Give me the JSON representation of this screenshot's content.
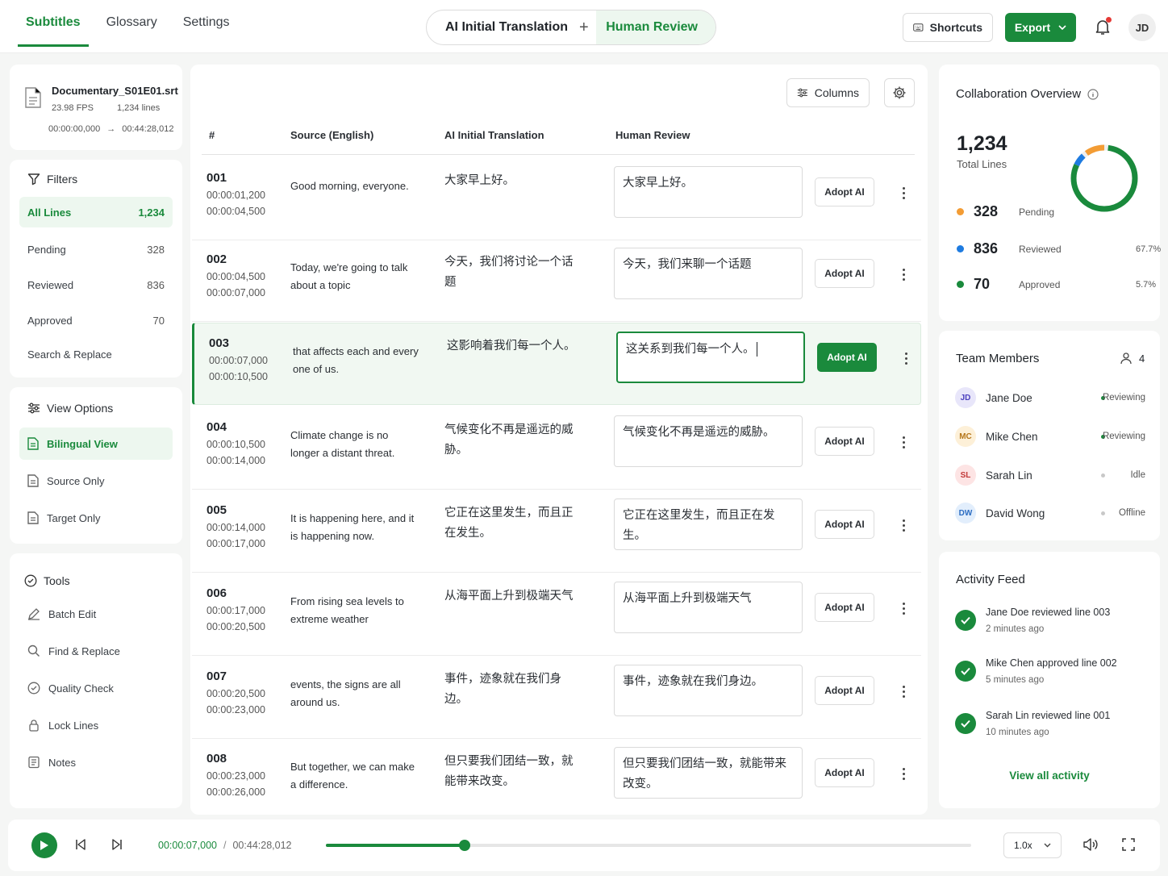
{
  "nav": {
    "tabs": [
      "Subtitles",
      "Glossary",
      "Settings"
    ],
    "active": 0
  },
  "mode": {
    "first": "AI Initial Translation",
    "second": "Human Review"
  },
  "topbar": {
    "shortcuts": "Shortcuts",
    "export": "Export",
    "avatar": "JD"
  },
  "file": {
    "name": "Documentary_S01E01.srt",
    "fps": "23.98 FPS",
    "lines": "1,234 lines",
    "start": "00:00:00,000",
    "arrow": "→",
    "end": "00:44:28,012"
  },
  "filters": {
    "title": "Filters",
    "items": [
      {
        "label": "All Lines",
        "count": "1,234"
      },
      {
        "label": "Pending",
        "count": "328"
      },
      {
        "label": "Reviewed",
        "count": "836"
      },
      {
        "label": "Approved",
        "count": "70"
      },
      {
        "label": "Search & Replace",
        "count": ""
      }
    ]
  },
  "view_options": {
    "title": "View Options",
    "items": [
      "Bilingual View",
      "Source Only",
      "Target Only"
    ]
  },
  "tools": {
    "title": "Tools",
    "items": [
      "Batch Edit",
      "Find & Replace",
      "Quality Check",
      "Lock Lines",
      "Notes"
    ]
  },
  "table": {
    "columns_btn": "Columns",
    "headers": [
      "#",
      "Source (English)",
      "AI Initial Translation",
      "Human Review"
    ],
    "adopt_label": "Adopt AI",
    "rows": [
      {
        "num": "001",
        "start": "00:00:01,200",
        "end": "00:00:04,500",
        "source": "Good morning, everyone.",
        "ai": "大家早上好。",
        "human": "大家早上好。"
      },
      {
        "num": "002",
        "start": "00:00:04,500",
        "end": "00:00:07,000",
        "source": "Today, we're going to talk about a topic",
        "ai": "今天，我们将讨论一个话题",
        "human": "今天，我们来聊一个话题"
      },
      {
        "num": "003",
        "start": "00:00:07,000",
        "end": "00:00:10,500",
        "source": "that affects each and every one of us.",
        "ai": "这影响着我们每一个人。",
        "human": "这关系到我们每一个人。"
      },
      {
        "num": "004",
        "start": "00:00:10,500",
        "end": "00:00:14,000",
        "source": "Climate change is no longer a distant threat.",
        "ai": "气候变化不再是遥远的威胁。",
        "human": "气候变化不再是遥远的威胁。"
      },
      {
        "num": "005",
        "start": "00:00:14,000",
        "end": "00:00:17,000",
        "source": "It is happening here, and it is happening now.",
        "ai": "它正在这里发生，而且正在发生。",
        "human": "它正在这里发生，而且正在发生。"
      },
      {
        "num": "006",
        "start": "00:00:17,000",
        "end": "00:00:20,500",
        "source": "From rising sea levels to extreme weather",
        "ai": "从海平面上升到极端天气",
        "human": "从海平面上升到极端天气"
      },
      {
        "num": "007",
        "start": "00:00:20,500",
        "end": "00:00:23,000",
        "source": "events, the signs are all around us.",
        "ai": "事件，迹象就在我们身边。",
        "human": "事件，迹象就在我们身边。"
      },
      {
        "num": "008",
        "start": "00:00:23,000",
        "end": "00:00:26,000",
        "source": "But together, we can make a difference.",
        "ai": "但只要我们团结一致，就能带来改变。",
        "human": "但只要我们团结一致，就能带来改变。"
      }
    ]
  },
  "overview": {
    "title": "Collaboration Overview",
    "total": "1,234",
    "total_label": "Total Lines",
    "stats": [
      {
        "num": "328",
        "label": "Pending",
        "pct": "",
        "color": "#f39c34",
        "fraction": 0.266
      },
      {
        "num": "836",
        "label": "Reviewed",
        "pct": "67.7%",
        "color": "#1e7be0",
        "fraction": 0.677
      },
      {
        "num": "70",
        "label": "Approved",
        "pct": "5.7%",
        "color": "#1a8a3c",
        "fraction": 0.057
      }
    ]
  },
  "team": {
    "title": "Team Members",
    "count": "4",
    "members": [
      {
        "initials": "JD",
        "name": "Jane Doe",
        "status": "Reviewing",
        "bg": "#e8e6fa",
        "fg": "#4b3fbf",
        "dot": "#1a8a3c"
      },
      {
        "initials": "MC",
        "name": "Mike Chen",
        "status": "Reviewing",
        "bg": "#fdf0d8",
        "fg": "#b5761a",
        "dot": "#1a8a3c"
      },
      {
        "initials": "SL",
        "name": "Sarah Lin",
        "status": "Idle",
        "bg": "#fde4e4",
        "fg": "#c23a3a",
        "dot": "#c8c8c8"
      },
      {
        "initials": "DW",
        "name": "David Wong",
        "status": "Offline",
        "bg": "#e2eefc",
        "fg": "#2b6cc2",
        "dot": "#c8c8c8"
      }
    ]
  },
  "activity": {
    "title": "Activity Feed",
    "items": [
      {
        "text": "Jane Doe reviewed line 003",
        "time": "2 minutes ago"
      },
      {
        "text": "Mike Chen approved line 002",
        "time": "5 minutes ago"
      },
      {
        "text": "Sarah Lin reviewed line 001",
        "time": "10 minutes ago"
      }
    ],
    "view_all": "View all activity"
  },
  "player": {
    "current": "00:00:07,000",
    "sep": "/",
    "total": "00:44:28,012",
    "progress": 0.215,
    "speed": "1.0x"
  },
  "colors": {
    "accent": "#1a8a3c"
  }
}
